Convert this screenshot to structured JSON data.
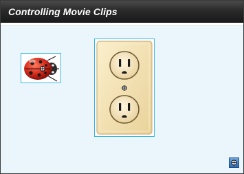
{
  "window": {
    "title": "Controlling Movie Clips"
  },
  "icons": {
    "ladybug": "ladybug-icon",
    "outlet": "power-outlet-icon",
    "registration_point": "crosshair-icon",
    "corner_button": "crosshair-button-icon"
  },
  "colors": {
    "titlebar": "#2b2b2b",
    "stage_background": "#ebf6fc",
    "selection_border": "#39b4e6",
    "outlet_plate": "#f3e1b0",
    "ladybug_red": "#d42a1c"
  }
}
